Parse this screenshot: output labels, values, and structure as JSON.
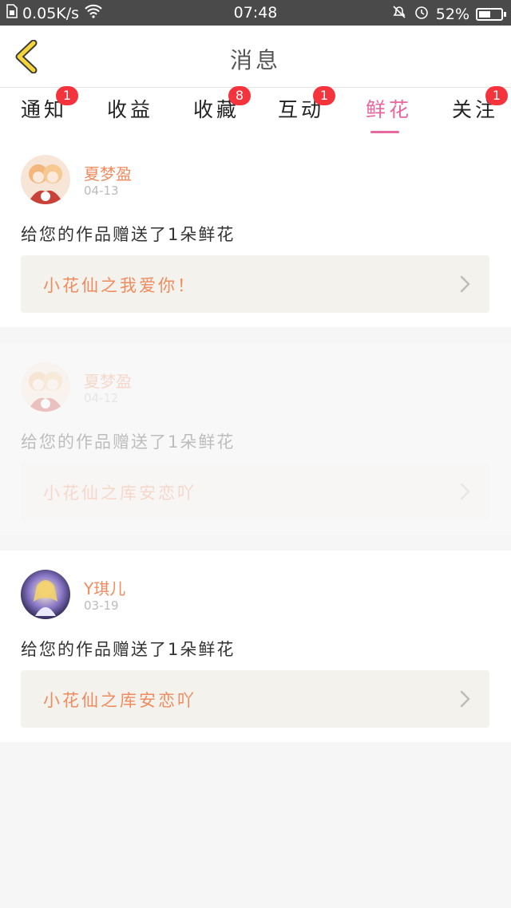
{
  "status_bar": {
    "speed": "0.05K/s",
    "time": "07:48",
    "battery": "52%",
    "battery_level": 0.52
  },
  "header": {
    "title": "消息"
  },
  "tabs": [
    {
      "label": "通知",
      "badge": "1"
    },
    {
      "label": "收益",
      "badge": ""
    },
    {
      "label": "收藏",
      "badge": "8"
    },
    {
      "label": "互动",
      "badge": "1"
    },
    {
      "label": "鲜花",
      "badge": ""
    },
    {
      "label": "关注",
      "badge": "1"
    }
  ],
  "messages": [
    {
      "sender": "夏梦盈",
      "date": "04-13",
      "text": "给您的作品赠送了1朵鲜花",
      "gift": "小花仙之我爱你！"
    },
    {
      "sender": "夏梦盈",
      "date": "04-12",
      "text": "给您的作品赠送了1朵鲜花",
      "gift": "小花仙之库安恋吖"
    },
    {
      "sender": "Y琪儿",
      "date": "03-19",
      "text": "给您的作品赠送了1朵鲜花",
      "gift": "小花仙之库安恋吖"
    }
  ],
  "colors": {
    "accent_pink": "#e8679f",
    "sender_orange": "#f08b5f",
    "badge_red": "#f4333c",
    "back_yellow": "#f5d53a"
  }
}
